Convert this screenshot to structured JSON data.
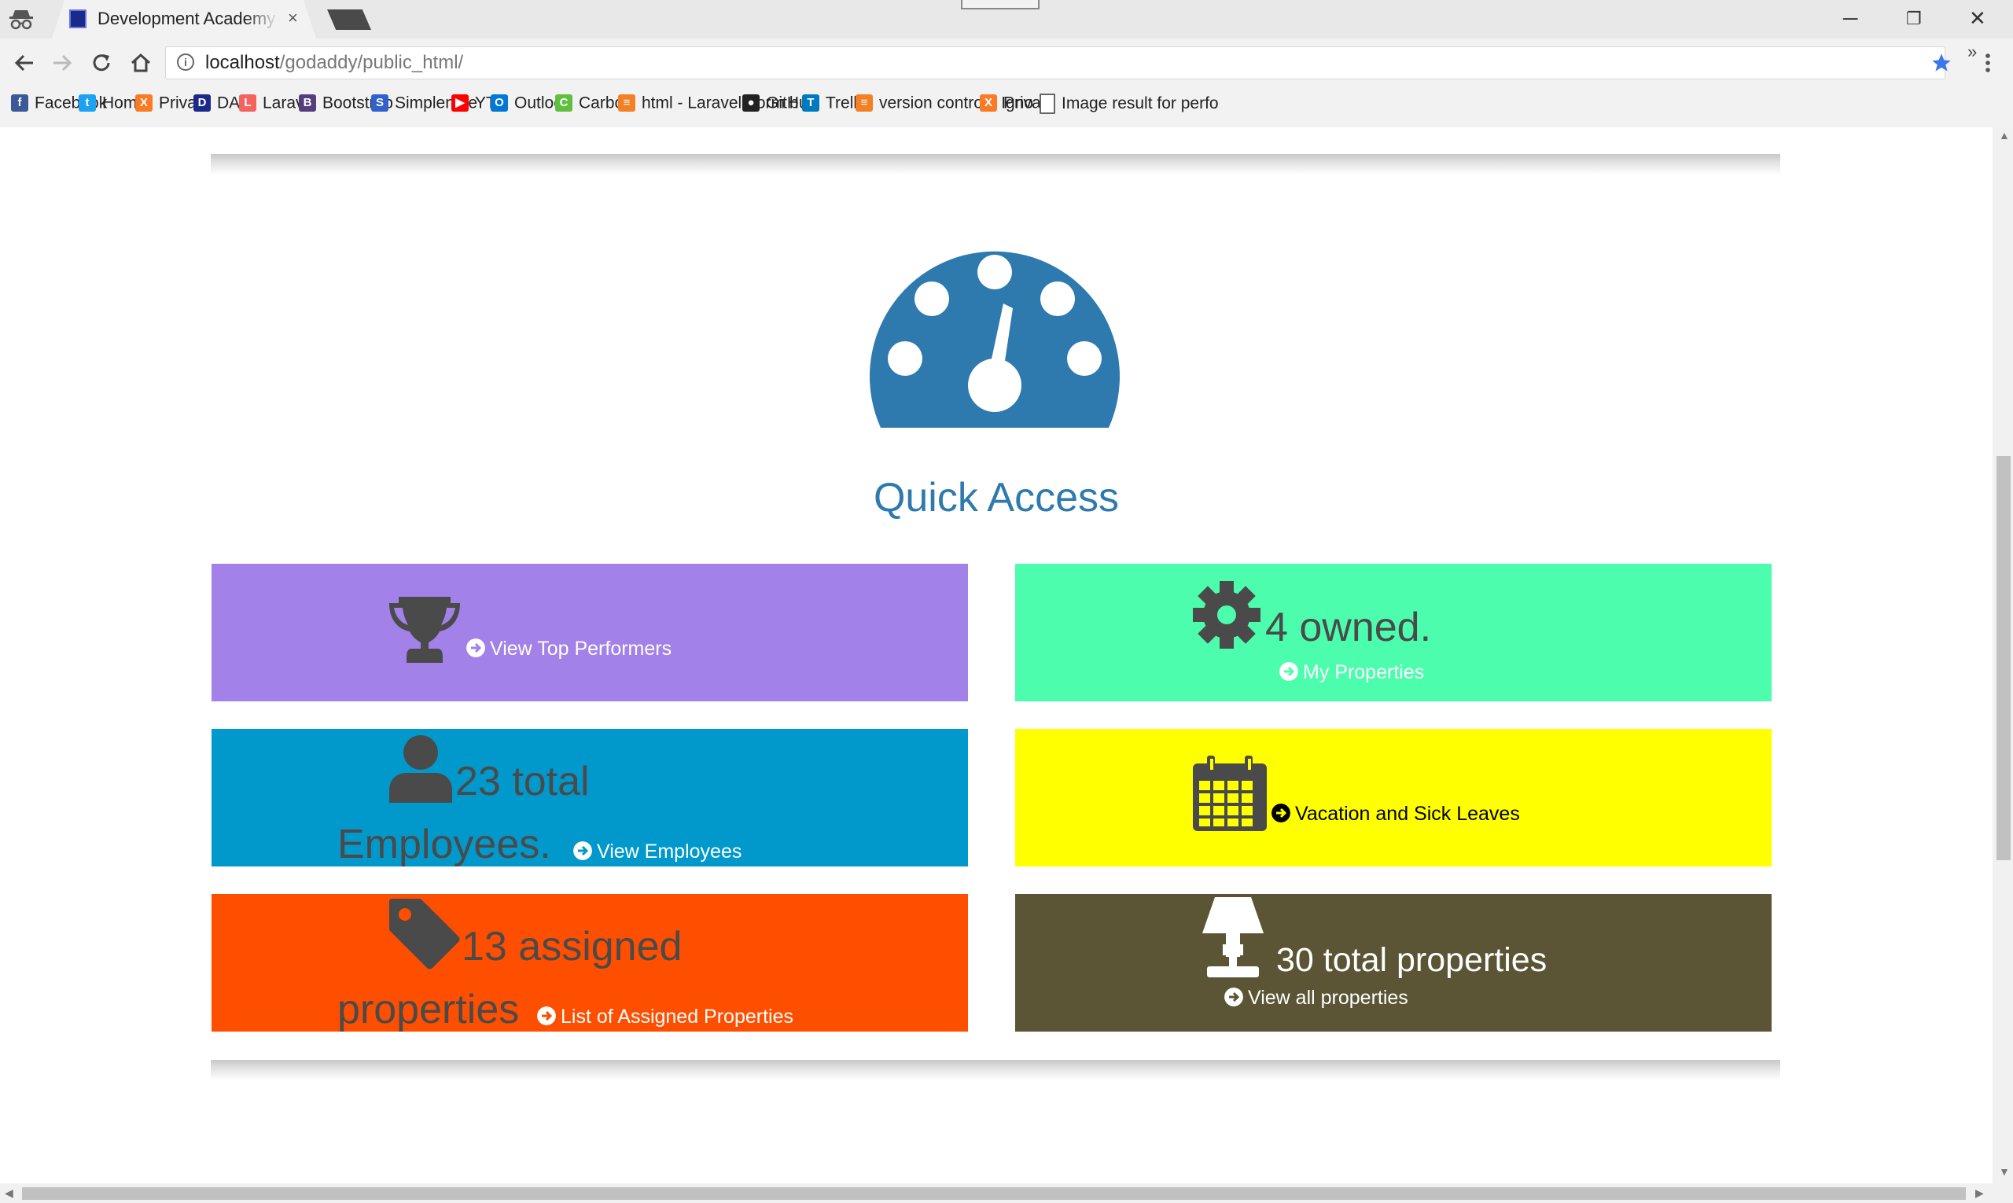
{
  "browser": {
    "tab_title": "Development Academy o",
    "tab_close": "×",
    "url_host": "localhost",
    "url_path": "/godaddy/public_html/",
    "bookmarks_more": "»",
    "window_controls": {
      "minimize": "─",
      "restore": "❐",
      "close": "✕"
    }
  },
  "bookmarks": [
    {
      "label": "Facebook",
      "icon": "facebook-icon",
      "color": "#3b5998",
      "glyph": "f"
    },
    {
      "label": "Home",
      "icon": "twitter-icon",
      "color": "#1da1f2",
      "glyph": "t"
    },
    {
      "label": "Privato",
      "icon": "xampp-icon",
      "color": "#fb7a24",
      "glyph": "X"
    },
    {
      "label": "DAP",
      "icon": "dap-icon",
      "color": "#1b2a8a",
      "glyph": "D"
    },
    {
      "label": "Laravel",
      "icon": "laravel-icon",
      "color": "#f4645f",
      "glyph": "L"
    },
    {
      "label": "Bootstrap",
      "icon": "bootstrap-icon",
      "color": "#563d7c",
      "glyph": "B"
    },
    {
      "label": "Simplenote",
      "icon": "simplenote-icon",
      "color": "#3361cc",
      "glyph": "S"
    },
    {
      "label": "YT",
      "icon": "youtube-icon",
      "color": "#ff0000",
      "glyph": "▶"
    },
    {
      "label": "Outlook",
      "icon": "outlook-icon",
      "color": "#0078d4",
      "glyph": "O"
    },
    {
      "label": "Carbon",
      "icon": "carbon-icon",
      "color": "#5fbf3f",
      "glyph": "C"
    },
    {
      "label": "html - Laravel Form b",
      "icon": "stackoverflow-icon",
      "color": "#f48024",
      "glyph": "≡"
    },
    {
      "label": "GitHub",
      "icon": "github-icon",
      "color": "#222222",
      "glyph": "●"
    },
    {
      "label": "Trello",
      "icon": "trello-icon",
      "color": "#0079bf",
      "glyph": "T"
    },
    {
      "label": "version control - Igno",
      "icon": "stackoverflow-icon",
      "color": "#f48024",
      "glyph": "≡"
    },
    {
      "label": "Privato",
      "icon": "xampp-icon",
      "color": "#fb7a24",
      "glyph": "X"
    },
    {
      "label": "Image result for perfo",
      "icon": "page-icon",
      "color": "#ffffff",
      "glyph": ""
    }
  ],
  "page": {
    "title": "Quick Access",
    "title_color": "#2e7aae",
    "cards": {
      "top_performers": {
        "link": "View Top Performers",
        "bg": "#a281e8",
        "icon": "trophy-icon"
      },
      "properties_owned": {
        "value": "4 owned.",
        "link": "My Properties",
        "bg": "#4bfdac",
        "icon": "gear-icon"
      },
      "employees": {
        "value_line1": "23 total",
        "value_line2": "Employees.",
        "link": "View Employees",
        "bg": "#0198cc",
        "icon": "user-icon"
      },
      "leaves": {
        "link": "Vacation and Sick Leaves",
        "bg": "#ffff00",
        "icon": "calendar-icon"
      },
      "assigned": {
        "value_line1": "13 assigned",
        "value_line2": "properties",
        "link": "List of Assigned Properties",
        "bg": "#fe4e00",
        "icon": "tag-icon"
      },
      "all_properties": {
        "value": "30 total properties",
        "link": "View all properties",
        "bg": "#5b5536",
        "icon": "lamp-icon"
      }
    }
  }
}
